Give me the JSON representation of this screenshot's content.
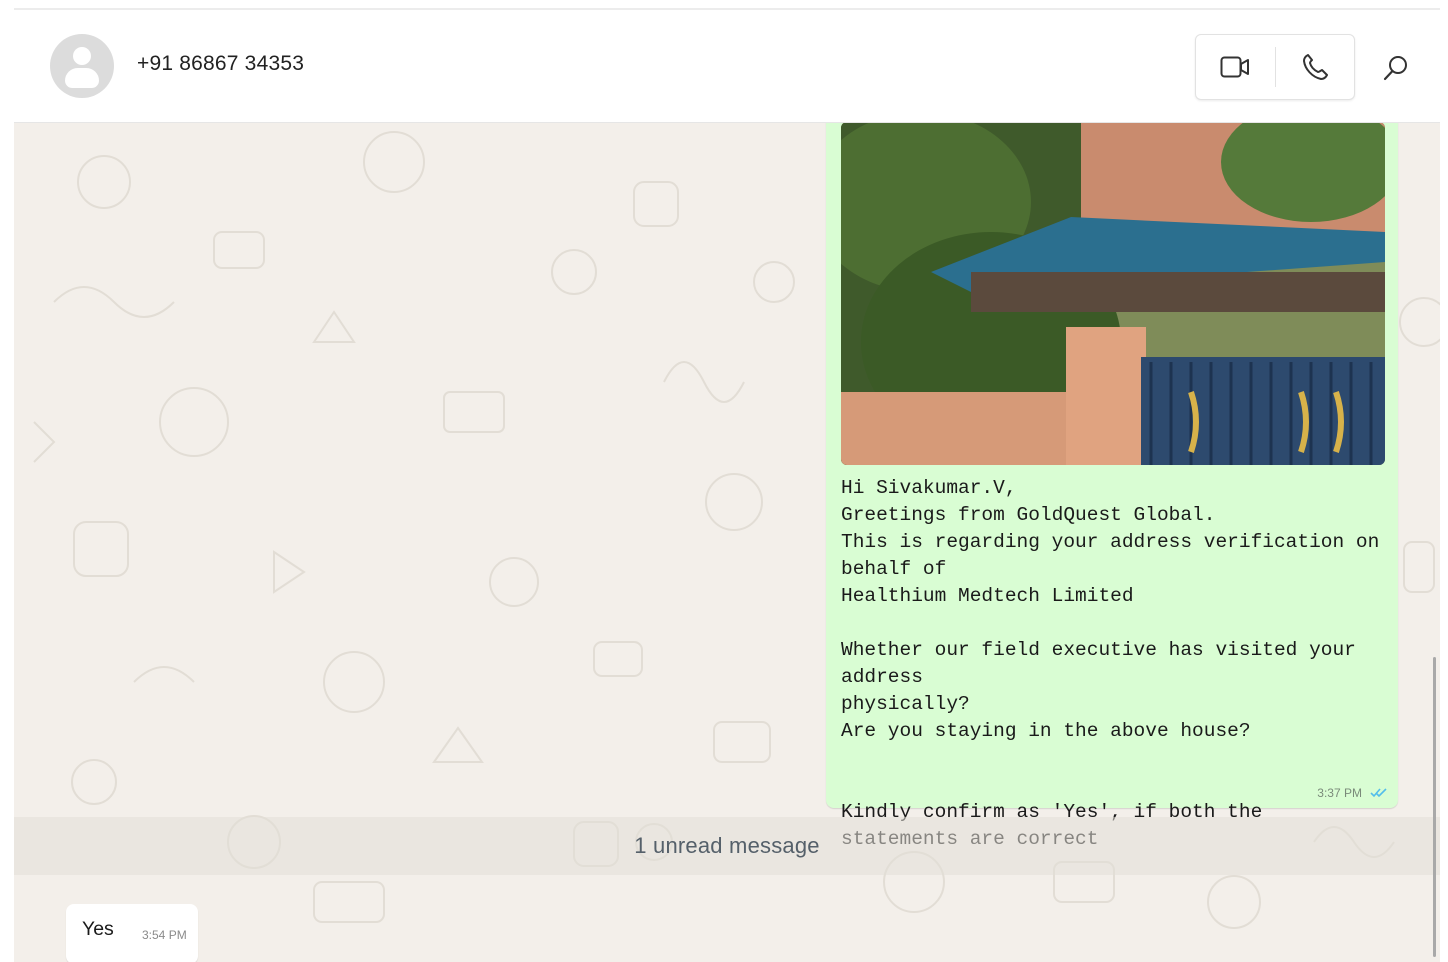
{
  "header": {
    "contact_name": "+91 86867 34353",
    "video_call_icon": "video-camera-icon",
    "voice_call_icon": "phone-icon",
    "search_icon": "search-icon"
  },
  "messages": {
    "outgoing": {
      "image": "house-photo",
      "text": "Hi Sivakumar.V,\nGreetings from GoldQuest Global.\nThis is regarding your address verification on behalf of\nHealthium Medtech Limited\n\nWhether our field executive has visited your address\nphysically?\nAre you staying in the above house?\n\n\nKindly confirm as 'Yes', if both the statements are correct",
      "time": "3:37 PM",
      "status_icon": "double-check-icon"
    },
    "unread_separator": "1 unread message",
    "incoming": {
      "text": "Yes",
      "time": "3:54 PM"
    }
  },
  "colors": {
    "outgoing_bubble": "#d9fdd3",
    "chat_background": "#efeae2",
    "read_tick": "#53bdeb"
  }
}
